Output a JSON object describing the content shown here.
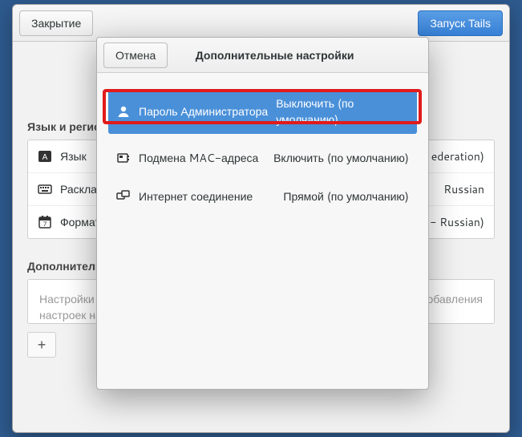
{
  "header": {
    "close_label": "Закрытие",
    "start_label": "Запуск Tails"
  },
  "sections": {
    "lang_region_title": "Язык и регион",
    "rows": {
      "language": {
        "label": "Язык",
        "value": "ederation)"
      },
      "keyboard": {
        "label": "Раскладка клавиатуры",
        "value": "Russian"
      },
      "formats": {
        "label": "Форматы",
        "value": " - Russian)"
      }
    },
    "additional_title": "Дополнительные настройки",
    "hint_text": "Настройки по умолчанию безопасны в большинстве ситуаций. Для добавления настроек нажмите кнопку «+».",
    "add_label": "+"
  },
  "dialog": {
    "cancel_label": "Отмена",
    "title": "Дополнительные настройки",
    "options": [
      {
        "label": "Пароль Администратора",
        "value": "Выключить (по умолчанию)"
      },
      {
        "label": "Подмена MAC-адреса",
        "value": "Включить (по умолчанию)"
      },
      {
        "label": "Интернет соединение",
        "value": "Прямой (по умолчанию)"
      }
    ]
  }
}
